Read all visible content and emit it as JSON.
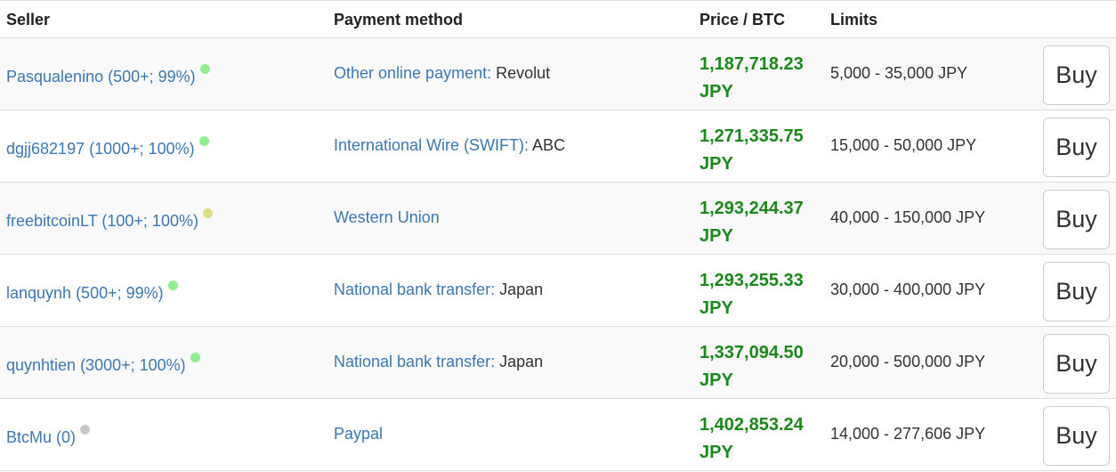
{
  "headers": {
    "seller": "Seller",
    "payment": "Payment method",
    "price": "Price / BTC",
    "limits": "Limits"
  },
  "colors": {
    "link": "#3c78b4",
    "price": "#1a8a1a",
    "status_online": "#90ee90",
    "status_away": "#dede88",
    "status_offline": "#c8c8c8"
  },
  "rows": [
    {
      "seller": "Pasqualenino (500+; 99%)",
      "status": "online",
      "payment_method": "Other online payment:",
      "payment_detail": " Revolut",
      "price_amount": "1,187,718.23",
      "price_currency": "JPY",
      "limits": "5,000 - 35,000 JPY",
      "buy_label": "Buy"
    },
    {
      "seller": "dgjj682197 (1000+; 100%)",
      "status": "online",
      "payment_method": "International Wire (SWIFT):",
      "payment_detail": " ABC",
      "price_amount": "1,271,335.75",
      "price_currency": "JPY",
      "limits": "15,000 - 50,000 JPY",
      "buy_label": "Buy"
    },
    {
      "seller": "freebitcoinLT (100+; 100%)",
      "status": "away",
      "payment_method": "Western Union",
      "payment_detail": "",
      "price_amount": "1,293,244.37",
      "price_currency": "JPY",
      "limits": "40,000 - 150,000 JPY",
      "buy_label": "Buy"
    },
    {
      "seller": "lanquynh (500+; 99%)",
      "status": "online",
      "payment_method": "National bank transfer:",
      "payment_detail": " Japan",
      "price_amount": "1,293,255.33",
      "price_currency": "JPY",
      "limits": "30,000 - 400,000 JPY",
      "buy_label": "Buy"
    },
    {
      "seller": "quynhtien (3000+; 100%)",
      "status": "online",
      "payment_method": "National bank transfer:",
      "payment_detail": " Japan",
      "price_amount": "1,337,094.50",
      "price_currency": "JPY",
      "limits": "20,000 - 500,000 JPY",
      "buy_label": "Buy"
    },
    {
      "seller": "BtcMu (0)",
      "status": "offline",
      "payment_method": "Paypal",
      "payment_detail": "",
      "price_amount": "1,402,853.24",
      "price_currency": "JPY",
      "limits": "14,000 - 277,606 JPY",
      "buy_label": "Buy"
    }
  ]
}
